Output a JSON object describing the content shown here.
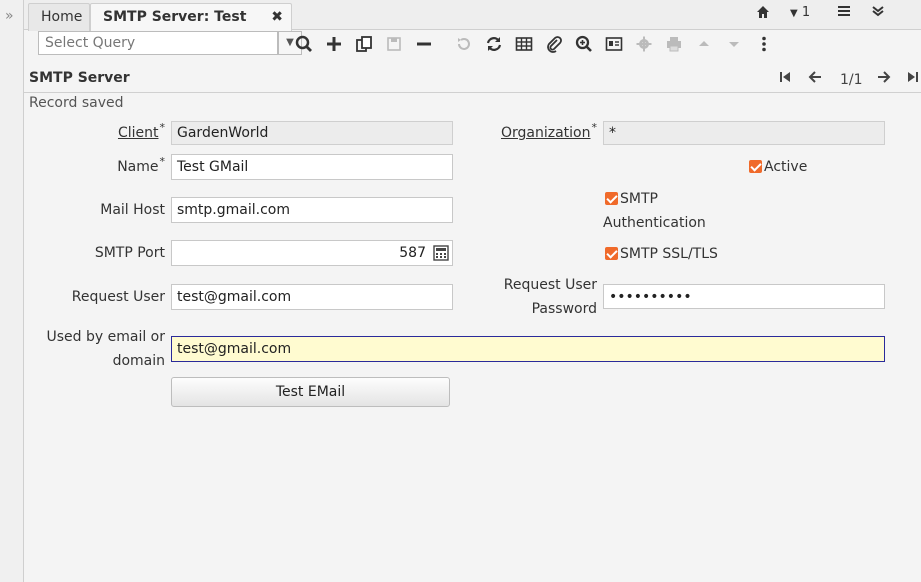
{
  "tabs": [
    {
      "label": "Home"
    },
    {
      "label": "SMTP Server: Test GMail"
    }
  ],
  "tabbar_right": {
    "notice_count": "1"
  },
  "query": {
    "placeholder": "Select Query"
  },
  "window": {
    "title": "SMTP Server",
    "record_nav": "1/1",
    "status": "Record saved"
  },
  "form": {
    "client": {
      "label": "Client",
      "value": "GardenWorld"
    },
    "organization": {
      "label": "Organization",
      "value": "*"
    },
    "name": {
      "label": "Name",
      "value": "Test GMail"
    },
    "active": {
      "label": "Active"
    },
    "mail_host": {
      "label": "Mail Host",
      "value": "smtp.gmail.com"
    },
    "smtp_auth": {
      "label_line1": "SMTP",
      "label_line2": "Authentication"
    },
    "smtp_port": {
      "label": "SMTP Port",
      "value": "587"
    },
    "smtp_ssl": {
      "label": "SMTP SSL/TLS"
    },
    "request_user": {
      "label": "Request User",
      "value": "test@gmail.com"
    },
    "request_password": {
      "label_line1": "Request User",
      "label_line2": "Password",
      "value": "••••••••••"
    },
    "used_by": {
      "label_line1": "Used by email or",
      "label_line2": "domain",
      "value": "test@gmail.com"
    },
    "test_button": "Test EMail"
  },
  "colors": {
    "checkbox": "#f06a2a",
    "focus_bg": "#fffbd0"
  }
}
